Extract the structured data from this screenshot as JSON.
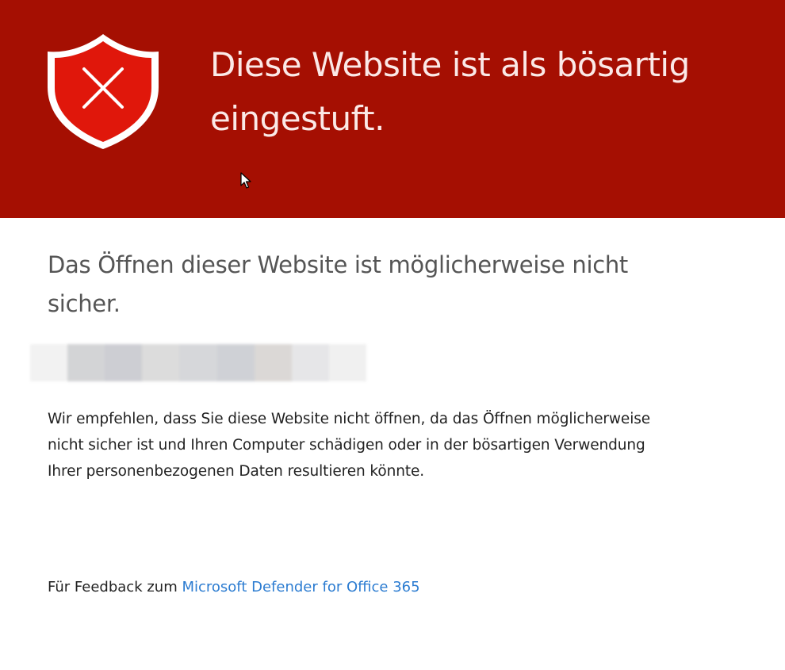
{
  "banner": {
    "title": "Diese Website ist als bösartig eingestuft.",
    "background_color": "#a50f02",
    "icon": "shield-x-icon"
  },
  "main": {
    "subtitle": "Das Öffnen dieser Website ist möglicherweise nicht sicher.",
    "url_redacted": true,
    "description": "Wir empfehlen, dass Sie diese Website nicht öffnen, da das Öffnen möglicherweise nicht sicher ist und Ihren Computer schädigen oder in der bösartigen Verwendung Ihrer personenbezogenen Daten resultieren könnte."
  },
  "footer": {
    "feedback_prefix": "Für Feedback zum",
    "feedback_link": "Microsoft Defender for Office 365",
    "link_color": "#2c7cd1"
  }
}
